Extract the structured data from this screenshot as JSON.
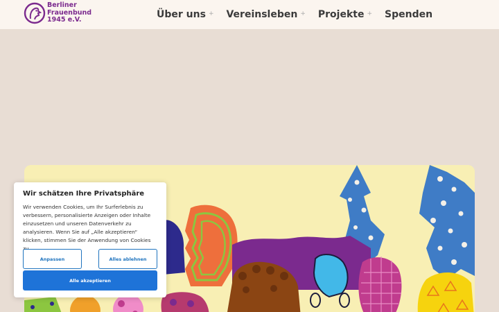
{
  "header": {
    "logo_lines": [
      "Berliner",
      "Frauenbund",
      "1945 e.V."
    ],
    "nav": [
      {
        "label": "Über uns",
        "has_submenu": true
      },
      {
        "label": "Vereinsleben",
        "has_submenu": true
      },
      {
        "label": "Projekte",
        "has_submenu": true
      },
      {
        "label": "Spenden",
        "has_submenu": false
      }
    ],
    "submenu_indicator": "+"
  },
  "cookie_banner": {
    "title": "Wir schätzen Ihre Privatsphäre",
    "text": "Wir verwenden Cookies, um Ihr Surferlebnis zu verbessern, personalisierte Anzeigen oder Inhalte einzusetzen und unseren Datenverkehr zu analysieren. Wenn Sie auf „Alle akzeptieren“ klicken, stimmen Sie der Anwendung von Cookies zu.",
    "customize_label": "Anpassen",
    "reject_label": "Alles ablehnen",
    "accept_label": "Alle akzeptieren"
  },
  "colors": {
    "brand_purple": "#7b2a8e",
    "button_blue": "#1e73d8",
    "page_background": "#e8ddd4",
    "header_background": "#fbf5ef"
  }
}
